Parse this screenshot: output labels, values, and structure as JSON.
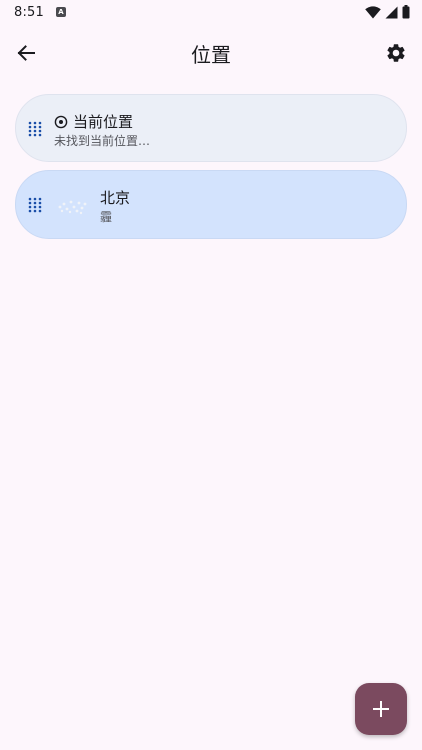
{
  "status_bar": {
    "time": "8:51",
    "app_icon_letter": "A"
  },
  "header": {
    "title": "位置",
    "back_icon": "arrow-back-icon",
    "settings_icon": "gear-icon"
  },
  "locations": [
    {
      "type": "current",
      "title": "当前位置",
      "subtitle": "未找到当前位置…",
      "icon": "target-icon"
    },
    {
      "type": "city",
      "title": "北京",
      "subtitle": "霾",
      "icon": "haze-icon"
    }
  ],
  "fab": {
    "icon": "plus-icon"
  },
  "colors": {
    "background": "#fdf6fc",
    "current_card": "#ebeff7",
    "city_card": "#d3e3fd",
    "drag_handle": "#1a4ea8",
    "fab": "#7b4a5f"
  }
}
